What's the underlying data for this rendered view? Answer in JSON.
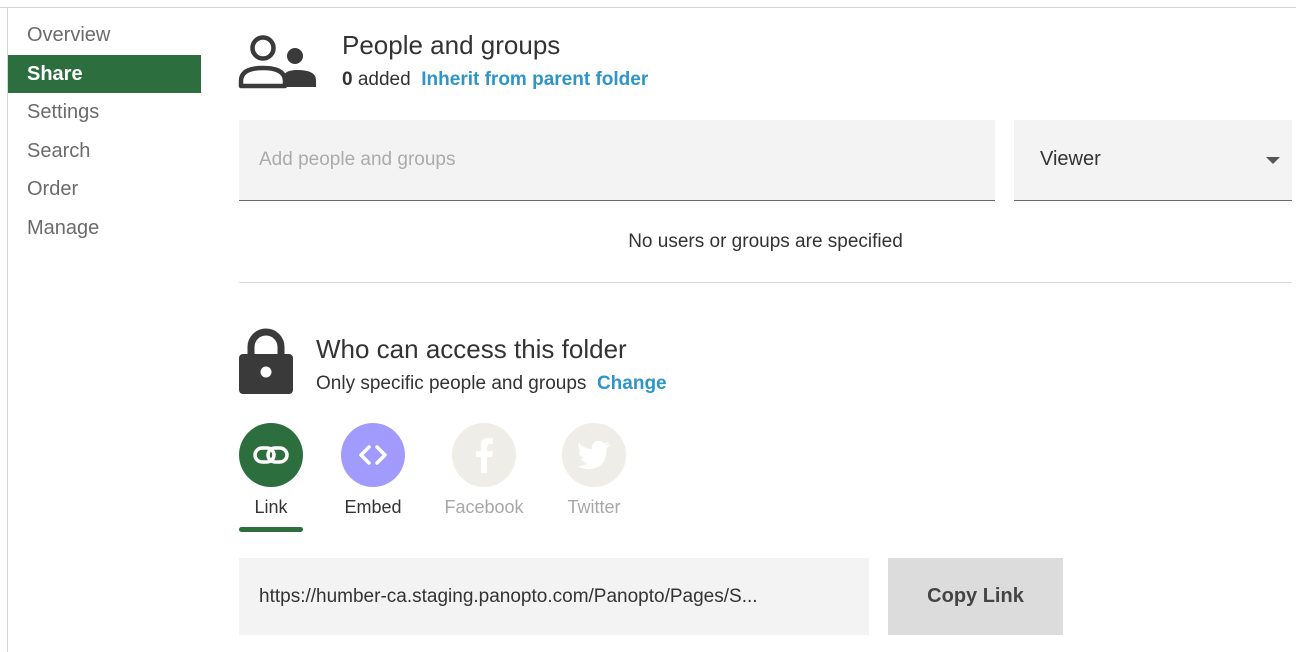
{
  "sidebar": {
    "items": [
      {
        "label": "Overview"
      },
      {
        "label": "Share"
      },
      {
        "label": "Settings"
      },
      {
        "label": "Search"
      },
      {
        "label": "Order"
      },
      {
        "label": "Manage"
      }
    ],
    "active": "Share"
  },
  "people": {
    "title": "People and groups",
    "count": "0",
    "count_suffix": " added",
    "inherit_link": "Inherit from parent folder",
    "input_placeholder": "Add people and groups",
    "role": "Viewer",
    "empty_message": "No users or groups are specified",
    "icon": "people-icon"
  },
  "access": {
    "title": "Who can access this folder",
    "subtitle": "Only specific people and groups",
    "change_link": "Change",
    "icon": "lock-icon"
  },
  "share_options": {
    "link": {
      "label": "Link",
      "icon": "link-icon"
    },
    "embed": {
      "label": "Embed",
      "icon": "code-icon"
    },
    "facebook": {
      "label": "Facebook",
      "icon": "facebook-icon"
    },
    "twitter": {
      "label": "Twitter",
      "icon": "twitter-icon"
    },
    "selected": "Link"
  },
  "link_bar": {
    "url": "https://humber-ca.staging.panopto.com/Panopto/Pages/S...",
    "copy_label": "Copy Link"
  },
  "colors": {
    "accent_green": "#2d6e3f",
    "link_blue": "#2d95c8",
    "embed_purple": "#a29bfe",
    "disabled_social": "#eeede7"
  }
}
